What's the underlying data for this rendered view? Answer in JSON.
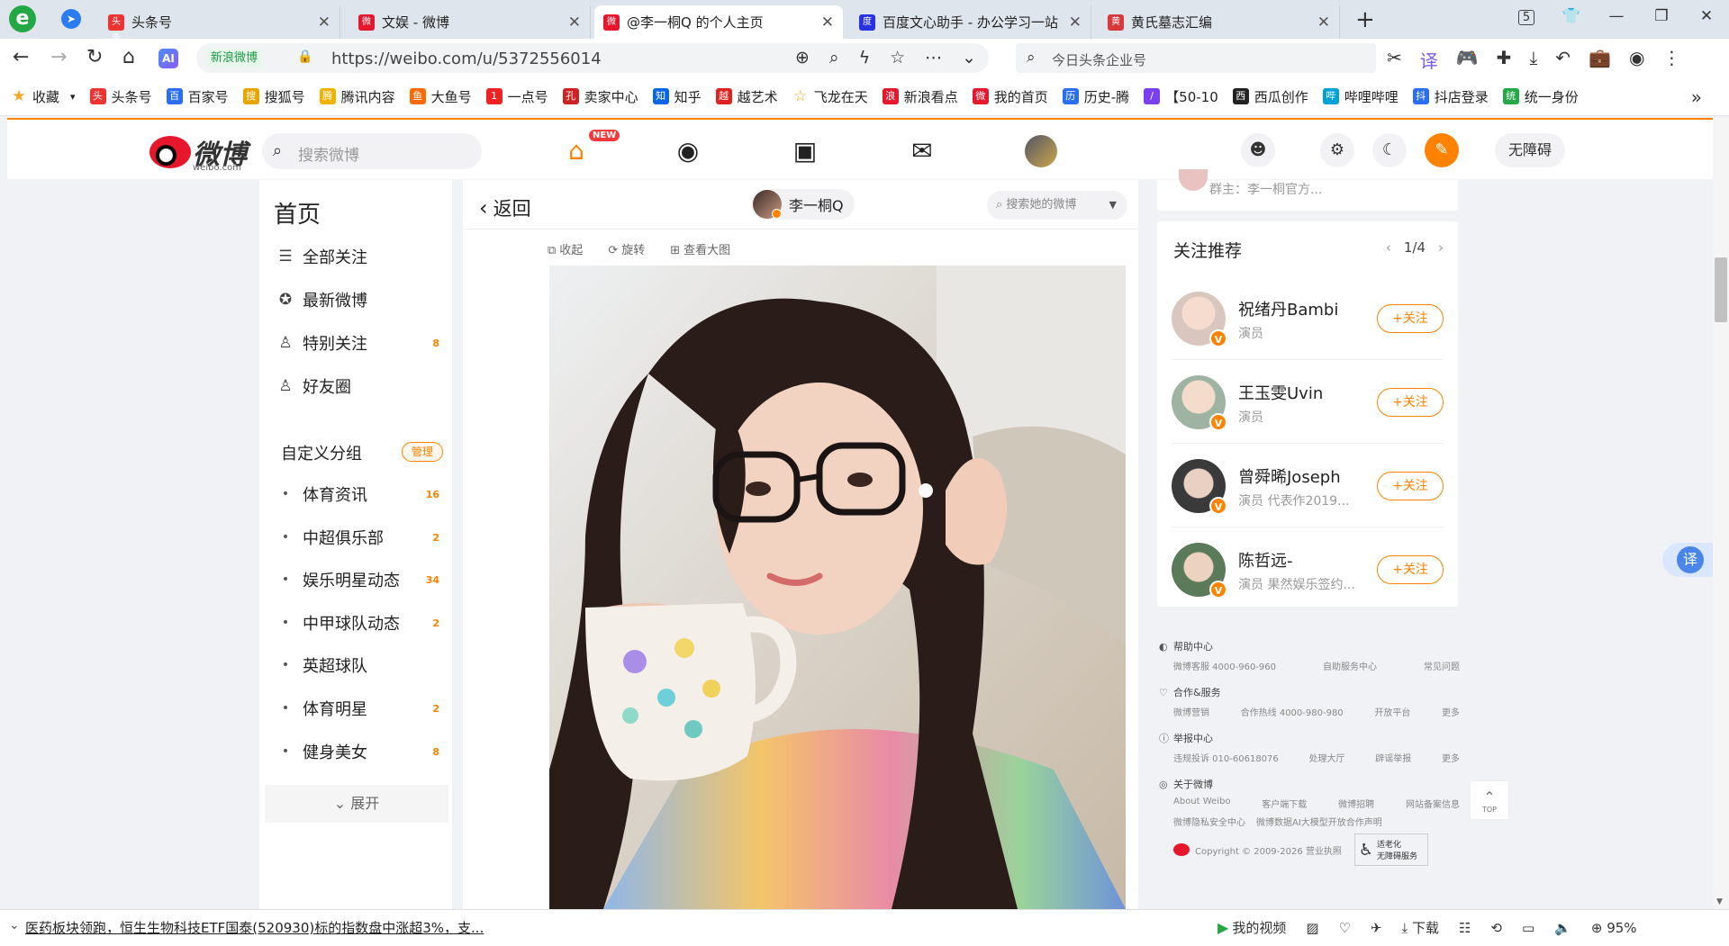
{
  "browser": {
    "tabs": [
      {
        "title": "头条号",
        "favicon": "头条",
        "color": "#e33"
      },
      {
        "title": "文娱 - 微博",
        "favicon": "微",
        "color": "#e6162d"
      },
      {
        "title": "@李一桐Q 的个人主页",
        "favicon": "微",
        "color": "#e6162d",
        "active": true
      },
      {
        "title": "百度文心助手 - 办公学习一站",
        "favicon": "度",
        "color": "#2932e1"
      },
      {
        "title": "黄氏墓志汇编",
        "favicon": "黄",
        "color": "#d9383a"
      }
    ],
    "tab_count": "5",
    "url_badge": "新浪微博",
    "url": "https://weibo.com/u/5372556014",
    "search_placeholder": "今日头条企业号",
    "bookmarks": [
      {
        "label": "收藏",
        "icon": "★",
        "color": "#f5a623"
      },
      {
        "label": "头条号",
        "icon": "头",
        "color": "#e33"
      },
      {
        "label": "百家号",
        "icon": "百",
        "color": "#2b6ff0"
      },
      {
        "label": "搜狐号",
        "icon": "搜",
        "color": "#e8a400"
      },
      {
        "label": "腾讯内容",
        "icon": "腾",
        "color": "#f0b400"
      },
      {
        "label": "大鱼号",
        "icon": "鱼",
        "color": "#ff6a00"
      },
      {
        "label": "一点号",
        "icon": "1",
        "color": "#e22"
      },
      {
        "label": "卖家中心",
        "icon": "孔",
        "color": "#c22"
      },
      {
        "label": "知乎",
        "icon": "知",
        "color": "#0a66e4"
      },
      {
        "label": "越艺术",
        "icon": "越",
        "color": "#d22"
      },
      {
        "label": "飞龙在天",
        "icon": "☆",
        "color": "#f5a623"
      },
      {
        "label": "新浪看点",
        "icon": "浪",
        "color": "#e6162d"
      },
      {
        "label": "我的首页",
        "icon": "微",
        "color": "#e6162d"
      },
      {
        "label": "历史-腾",
        "icon": "历",
        "color": "#2b6ff0"
      },
      {
        "label": "【50-10",
        "icon": "/",
        "color": "#7a3ff0"
      },
      {
        "label": "西瓜创作",
        "icon": "西",
        "color": "#222"
      },
      {
        "label": "哔哩哔哩",
        "icon": "哔",
        "color": "#00a1d6"
      },
      {
        "label": "抖店登录",
        "icon": "抖",
        "color": "#2b6ff0"
      },
      {
        "label": "统一身份",
        "icon": "统",
        "color": "#23a845"
      }
    ]
  },
  "weibo": {
    "logo_text": "微博",
    "logo_sub": "weibo.com",
    "search_placeholder": "搜索微博",
    "new_badge": "NEW",
    "accessibility_label": "无障碍",
    "left_nav": {
      "title": "首页",
      "items": [
        {
          "label": "全部关注",
          "icon": "☰",
          "count": ""
        },
        {
          "label": "最新微博",
          "icon": "✪",
          "count": ""
        },
        {
          "label": "特别关注",
          "icon": "♙",
          "count": "8"
        },
        {
          "label": "好友圈",
          "icon": "♙",
          "count": ""
        }
      ],
      "group_title": "自定义分组",
      "manage_label": "管理",
      "groups": [
        {
          "label": "体育资讯",
          "count": "16"
        },
        {
          "label": "中超俱乐部",
          "count": "2"
        },
        {
          "label": "娱乐明星动态",
          "count": "34"
        },
        {
          "label": "中甲球队动态",
          "count": "2"
        },
        {
          "label": "英超球队",
          "count": ""
        },
        {
          "label": "体育明星",
          "count": "2"
        },
        {
          "label": "健身美女",
          "count": "8"
        }
      ],
      "expand_label": "展开"
    },
    "center": {
      "back_label": "返回",
      "user_name": "李一桐Q",
      "search_placeholder": "搜索她的微博",
      "tools": [
        {
          "label": "收起",
          "icon": "⧉"
        },
        {
          "label": "旋转",
          "icon": "⟳"
        },
        {
          "label": "查看大图",
          "icon": "⊞"
        }
      ]
    },
    "right": {
      "group_text": "群主：李一桐官方...",
      "rec_title": "关注推荐",
      "rec_page": "1/4",
      "follow_label": "+关注",
      "recommendations": [
        {
          "name": "祝绪丹Bambi",
          "desc": "演员",
          "color": "#d8c6bf"
        },
        {
          "name": "王玉雯Uvin",
          "desc": "演员",
          "color": "#9fb3a2"
        },
        {
          "name": "曾舜晞Joseph",
          "desc": "演员 代表作2019...",
          "color": "#3a3a3a"
        },
        {
          "name": "陈哲远-",
          "desc": "演员 果然娱乐签约...",
          "color": "#5a7a5a"
        }
      ],
      "footer": {
        "help_title": "帮助中心",
        "help_row": [
          "微博客服 4000-960-960",
          "自助服务中心",
          "常见问题"
        ],
        "coop_title": "合作&服务",
        "coop_row": [
          "微博营销",
          "合作热线 4000-980-980",
          "开放平台",
          "更多"
        ],
        "report_title": "举报中心",
        "report_row": [
          "违规投诉 010-60618076",
          "处理大厅",
          "辟谣举报",
          "更多"
        ],
        "about_title": "关于微博",
        "about_row1": [
          "About Weibo",
          "客户端下载",
          "微博招聘",
          "网站备案信息"
        ],
        "about_row2": [
          "微博隐私安全中心",
          "微博数据AI大模型开放合作声明"
        ],
        "copyright": "Copyright © 2009-2026 营业执照",
        "access_badge_1": "适老化",
        "access_badge_2": "无障碍服务"
      },
      "top_label": "TOP",
      "translate_label": "译"
    }
  },
  "status_bar": {
    "news": "医药板块领跑，恒生生物科技ETF国泰(520930)标的指数盘中涨超3%，支...",
    "my_video": "我的视频",
    "download": "下载",
    "zoom": "95%"
  }
}
